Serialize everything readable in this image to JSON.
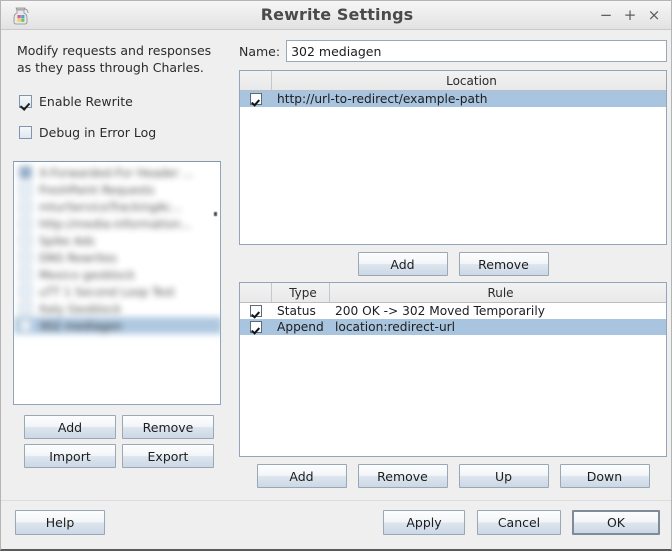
{
  "window": {
    "title": "Rewrite Settings",
    "icon": "charles-jar-icon",
    "controls": {
      "minimize": "−",
      "maximize": "+",
      "close": "×"
    }
  },
  "left": {
    "intro": "Modify requests and responses as they pass through Charles.",
    "checkboxes": [
      {
        "label": "Enable Rewrite",
        "checked": true
      },
      {
        "label": "Debug in Error Log",
        "checked": false
      }
    ],
    "list": {
      "rows": [
        {
          "label": "X-Forwarded-For Header ...",
          "checked": true,
          "selected": false
        },
        {
          "label": "FreshPaint Requests",
          "checked": false,
          "selected": false
        },
        {
          "label": "mturServiceTrackingAc...",
          "checked": false,
          "selected": false
        },
        {
          "label": "http://media-information...",
          "checked": false,
          "selected": false
        },
        {
          "label": "Spike Ads",
          "checked": false,
          "selected": false
        },
        {
          "label": "DNS Rewrites",
          "checked": false,
          "selected": false
        },
        {
          "label": "Mexico geoblock",
          "checked": false,
          "selected": false
        },
        {
          "label": "uTT 1 Second Loop Test",
          "checked": false,
          "selected": false
        },
        {
          "label": "Italy Geoblock",
          "checked": false,
          "selected": false
        },
        {
          "label": "302 mediagen",
          "checked": true,
          "selected": true
        }
      ]
    },
    "buttons": {
      "add": "Add",
      "remove": "Remove",
      "import": "Import",
      "export": "Export"
    }
  },
  "right": {
    "name_label": "Name:",
    "name_value": "302 mediagen",
    "location_table": {
      "headers": {
        "check": "",
        "location": "Location"
      },
      "rows": [
        {
          "checked": true,
          "location": "http://url-to-redirect/example-path",
          "selected": true
        }
      ]
    },
    "location_buttons": {
      "add": "Add",
      "remove": "Remove"
    },
    "rule_table": {
      "headers": {
        "check": "",
        "type": "Type",
        "rule": "Rule"
      },
      "rows": [
        {
          "checked": true,
          "type": "Status",
          "rule": "200 OK -> 302 Moved Temporarily",
          "selected": false
        },
        {
          "checked": true,
          "type": "Append",
          "rule": "location:redirect-url",
          "selected": true
        }
      ]
    },
    "rule_buttons": {
      "add": "Add",
      "remove": "Remove",
      "up": "Up",
      "down": "Down"
    }
  },
  "bottom": {
    "help": "Help",
    "apply": "Apply",
    "cancel": "Cancel",
    "ok": "OK"
  },
  "colors": {
    "dialog_bg": "#efefef",
    "selection": "#a8c4de",
    "table_border": "#93a5ba",
    "header_bg": "#ececec",
    "text": "#1d1d1d"
  }
}
